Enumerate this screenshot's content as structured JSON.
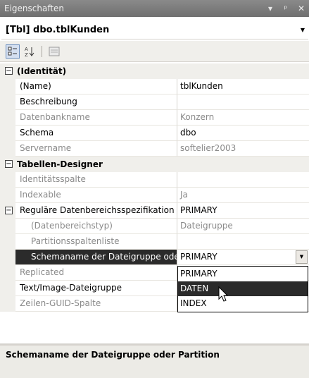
{
  "window": {
    "title": "Eigenschaften",
    "buttons": [
      "▾",
      "ᵖ",
      "✕"
    ]
  },
  "object_selector": {
    "value": "[Tbl] dbo.tblKunden"
  },
  "toolbar": {
    "icons": [
      "categorized-icon",
      "alphabetical-sort-icon",
      "property-pages-icon"
    ],
    "sort_label": "A↓Z"
  },
  "categories": {
    "identitaet": {
      "label": "(Identität)",
      "toggle": "−"
    },
    "tabellen_designer": {
      "label": "Tabellen-Designer",
      "toggle": "−"
    },
    "regulaere": {
      "toggle": "−"
    }
  },
  "properties": [
    {
      "name": "(Name)",
      "value": "tblKunden"
    },
    {
      "name": "Beschreibung",
      "value": ""
    },
    {
      "name": "Datenbankname",
      "value": "Konzern"
    },
    {
      "name": "Schema",
      "value": "dbo"
    },
    {
      "name": "Servername",
      "value": "softelier2003"
    },
    {
      "name": "Identitätsspalte",
      "value": ""
    },
    {
      "name": "Indexable",
      "value": "Ja"
    },
    {
      "name": "Reguläre Datenbereichsspezifikation",
      "value": "PRIMARY"
    },
    {
      "name": "(Datenbereichstyp)",
      "value": "Dateigruppe"
    },
    {
      "name": "Partitionsspaltenliste",
      "value": ""
    },
    {
      "name": "Schemaname der Dateigruppe oder Partition",
      "value": "PRIMARY"
    },
    {
      "name": "Replicated",
      "value": ""
    },
    {
      "name": "Text/Image-Dateigruppe",
      "value": ""
    },
    {
      "name": "Zeilen-GUID-Spalte",
      "value": ""
    }
  ],
  "dropdown": {
    "options": [
      "PRIMARY",
      "DATEN",
      "INDEX"
    ],
    "highlighted": "DATEN"
  },
  "description": {
    "title": "Schemaname der Dateigruppe oder Partition"
  }
}
